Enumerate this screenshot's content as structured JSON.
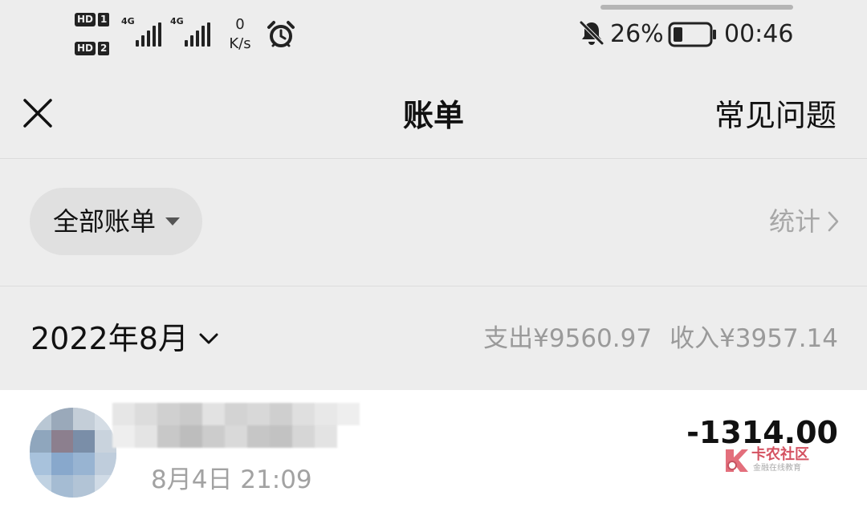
{
  "status_bar": {
    "sim1_badge": "HD",
    "sim1_number": "1",
    "sim2_badge": "HD",
    "sim2_number": "2",
    "sim1_network": "4G",
    "sim2_network": "4G",
    "net_speed_value": "0",
    "net_speed_unit": "K/s",
    "battery_percent": "26%",
    "battery_level": 0.26,
    "time": "00:46",
    "icons": [
      "alarm-icon",
      "bell-off-icon",
      "battery-icon",
      "signal-icon"
    ]
  },
  "header": {
    "close_icon": "close-icon",
    "title": "账单",
    "faq_label": "常见问题"
  },
  "filters": {
    "all_bills_label": "全部账单",
    "stats_label": "统计"
  },
  "month": {
    "label": "2022年8月",
    "expense_label": "支出",
    "expense_amount": "¥9560.97",
    "income_label": "收入",
    "income_amount": "¥3957.14"
  },
  "transactions": [
    {
      "amount": "-1314.00",
      "date": "8月4日 21:09"
    }
  ],
  "watermark": {
    "title": "卡农社区",
    "subtitle": "金融在线教育"
  },
  "colors": {
    "background": "#ededed",
    "card": "#ffffff",
    "muted_text": "#9a9a9a",
    "primary_text": "#111111",
    "watermark_red": "#d04050"
  }
}
